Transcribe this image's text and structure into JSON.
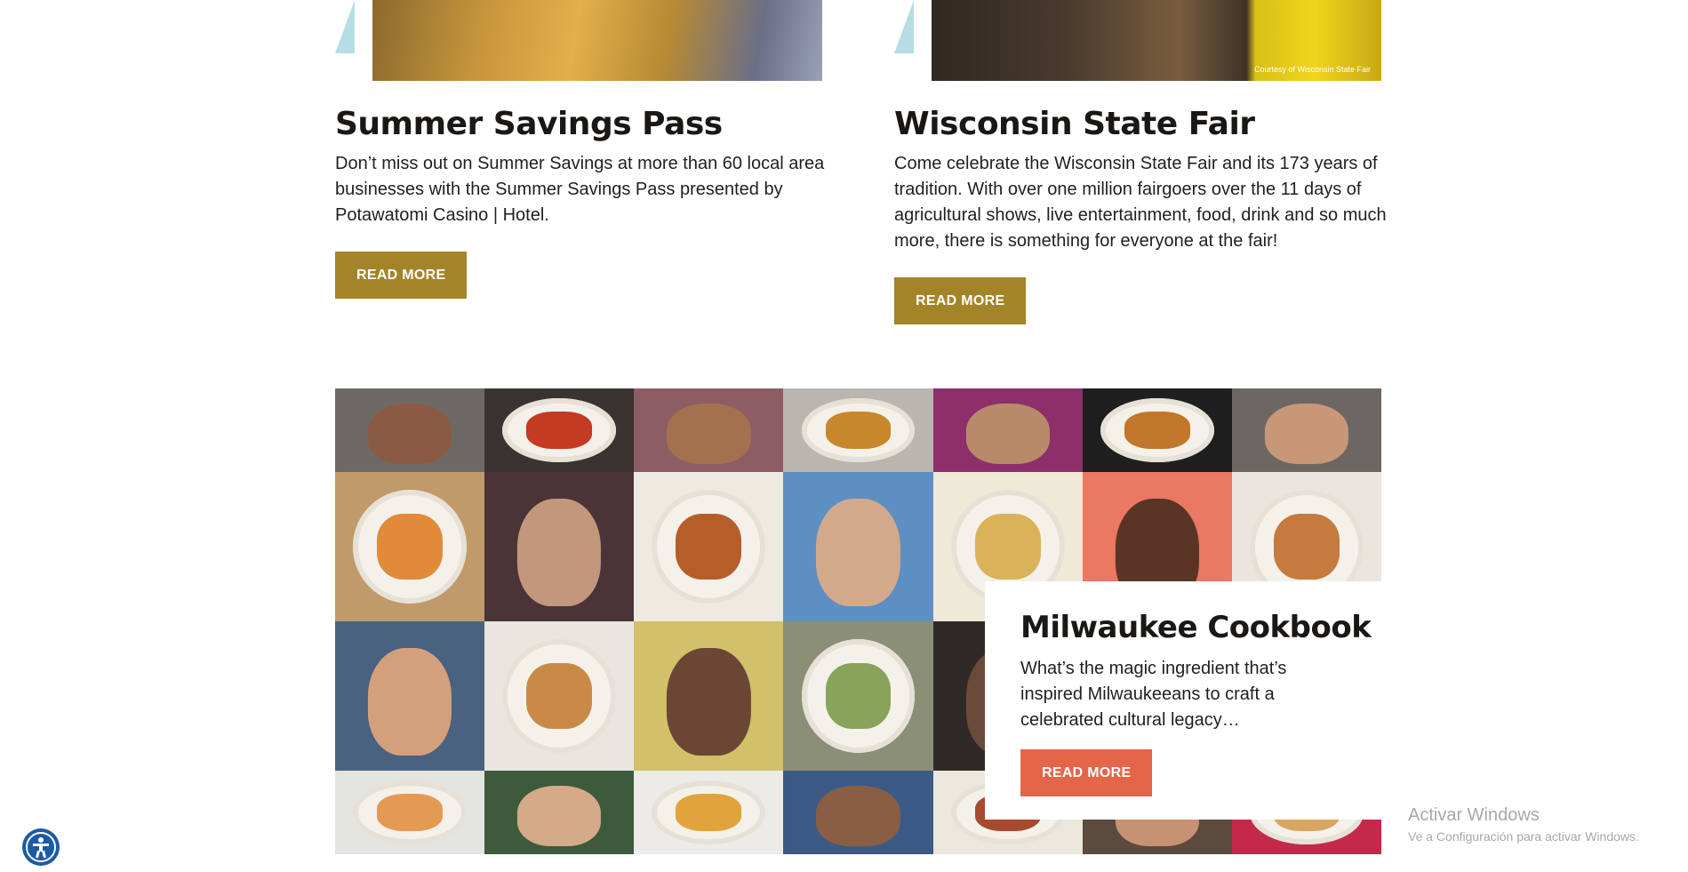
{
  "cards": [
    {
      "title": "Summer Savings Pass",
      "description": "Don’t miss out on Summer Savings at more than 60 local area businesses with the Summer Savings Pass presented by Potawatomi Casino | Hotel.",
      "button_label": "READ MORE"
    },
    {
      "title": "Wisconsin State Fair",
      "description": "Come celebrate the Wisconsin State Fair and its 173 years of tradition. With over one million fairgoers over the 11 days of agricultural shows, live entertainment, food, drink and so much more, there is something for everyone at the fair!",
      "button_label": "READ MORE",
      "photo_credit": "Courtesy of Wisconsin State Fair"
    }
  ],
  "feature": {
    "title": "Milwaukee Cookbook",
    "description": "What’s the magic ingredient that’s inspired Milwaukeeans to craft a celebrated cultural legacy…",
    "button_label": "READ MORE"
  },
  "mosaic_tiles": [
    {
      "kind": "portrait",
      "bg": "#6d6a66",
      "fg": "#8a5a44"
    },
    {
      "kind": "food",
      "bg": "#3a3330",
      "fg": "#c43a22"
    },
    {
      "kind": "portrait",
      "bg": "#8c5d64",
      "fg": "#a5704e"
    },
    {
      "kind": "food",
      "bg": "#b9b6b0",
      "fg": "#c9872c"
    },
    {
      "kind": "portrait",
      "bg": "#8c2f6a",
      "fg": "#b88a6a"
    },
    {
      "kind": "food",
      "bg": "#1f1f1f",
      "fg": "#c2762b"
    },
    {
      "kind": "portrait",
      "bg": "#6c6763",
      "fg": "#c79778"
    },
    {
      "kind": "food",
      "bg": "#c09a6a",
      "fg": "#e08a3a"
    },
    {
      "kind": "portrait",
      "bg": "#4a3438",
      "fg": "#c2977c"
    },
    {
      "kind": "food",
      "bg": "#eeeae2",
      "fg": "#b65e2a"
    },
    {
      "kind": "portrait",
      "bg": "#5d8fc2",
      "fg": "#d3a98c"
    },
    {
      "kind": "food",
      "bg": "#efe9d8",
      "fg": "#d9b25a"
    },
    {
      "kind": "portrait",
      "bg": "#ea7862",
      "fg": "#5a3526"
    },
    {
      "kind": "food",
      "bg": "#eae6df",
      "fg": "#c57a3e"
    },
    {
      "kind": "portrait",
      "bg": "#496280",
      "fg": "#d4a07c"
    },
    {
      "kind": "food",
      "bg": "#e9e6df",
      "fg": "#c98a48"
    },
    {
      "kind": "portrait",
      "bg": "#d2c06a",
      "fg": "#6c4634"
    },
    {
      "kind": "food",
      "bg": "#8a8f76",
      "fg": "#88a45a"
    },
    {
      "kind": "portrait",
      "bg": "#2f2a28",
      "fg": "#6b4a3a"
    },
    {
      "kind": "portrait",
      "bg": "#3a3432",
      "fg": "#7a5a48"
    },
    {
      "kind": "portrait",
      "bg": "#4a3c36",
      "fg": "#8a6a58"
    },
    {
      "kind": "food",
      "bg": "#e3e3e0",
      "fg": "#e59a54"
    },
    {
      "kind": "portrait",
      "bg": "#3e5a3c",
      "fg": "#d4aa88"
    },
    {
      "kind": "food",
      "bg": "#ecebe7",
      "fg": "#e0a43a"
    },
    {
      "kind": "portrait",
      "bg": "#3b5a86",
      "fg": "#8a5e44"
    },
    {
      "kind": "food",
      "bg": "#ece7dc",
      "fg": "#a84a30"
    },
    {
      "kind": "portrait",
      "bg": "#5c4a3e",
      "fg": "#c79272"
    },
    {
      "kind": "food",
      "bg": "#c4294a",
      "fg": "#d8a664"
    }
  ],
  "accessibility_icon": "accessibility-icon",
  "watermark": {
    "line1": "Activar Windows",
    "line2": "Ve a Configuración para activar Windows."
  },
  "colors": {
    "gold_button": "#a48428",
    "coral_button": "#e3654a",
    "accent_triangle": "#b6dde5",
    "a11y_blue": "#1b5aa6"
  }
}
